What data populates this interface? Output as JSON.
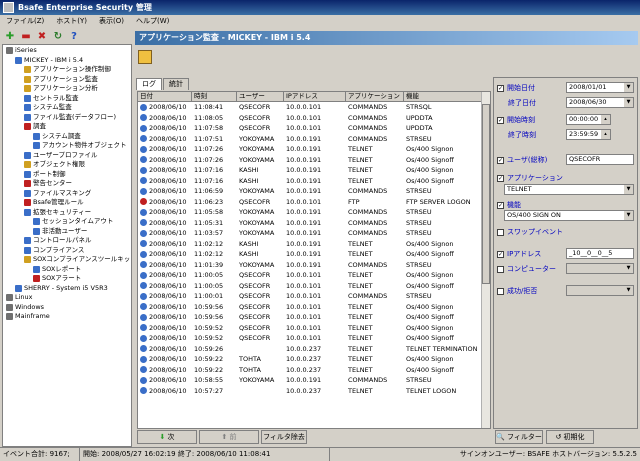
{
  "window": {
    "title": "Bsafe Enterprise Security 管理"
  },
  "menu": [
    "ファイル(Z)",
    "ホスト(Y)",
    "表示(O)",
    "ヘルプ(W)"
  ],
  "toolbar_icons": [
    {
      "name": "add-icon",
      "glyph": "✚",
      "color": "#2a9d2a"
    },
    {
      "name": "remove-icon",
      "glyph": "▬",
      "color": "#c02020"
    },
    {
      "name": "delete-icon",
      "glyph": "✖",
      "color": "#c02020"
    },
    {
      "name": "refresh-icon",
      "glyph": "↻",
      "color": "#2a7a2a"
    },
    {
      "name": "help-icon",
      "glyph": "?",
      "color": "#1f4fbf"
    }
  ],
  "tree": [
    {
      "label": "iSeries",
      "indent": 0,
      "color": "#707070"
    },
    {
      "label": "MICKEY - IBM i 5.4",
      "indent": 1,
      "color": "#3a6ec8"
    },
    {
      "label": "アプリケーション操作制御",
      "indent": 2,
      "color": "#d0a020"
    },
    {
      "label": "アプリケーション監査",
      "indent": 2,
      "color": "#d0a020"
    },
    {
      "label": "アプリケーション分析",
      "indent": 2,
      "color": "#d0a020"
    },
    {
      "label": "セントラル監査",
      "indent": 2,
      "color": "#3a6ec8"
    },
    {
      "label": "システム監査",
      "indent": 2,
      "color": "#3a6ec8"
    },
    {
      "label": "ファイル監査(データフロー)",
      "indent": 2,
      "color": "#3a6ec8"
    },
    {
      "label": "調査",
      "indent": 2,
      "color": "#c02020"
    },
    {
      "label": "システム調査",
      "indent": 3,
      "color": "#3a6ec8"
    },
    {
      "label": "アカウント物件オブジェクト",
      "indent": 3,
      "color": "#3a6ec8"
    },
    {
      "label": "ユーザープロファイル",
      "indent": 2,
      "color": "#3a6ec8"
    },
    {
      "label": "オブジェクト権限",
      "indent": 2,
      "color": "#d0a020"
    },
    {
      "label": "ポート制御",
      "indent": 2,
      "color": "#3a6ec8"
    },
    {
      "label": "警告センター",
      "indent": 2,
      "color": "#c02020"
    },
    {
      "label": "ファイルマスキング",
      "indent": 2,
      "color": "#3a6ec8"
    },
    {
      "label": "Bsafe管理ルール",
      "indent": 2,
      "color": "#c02020"
    },
    {
      "label": "拡張セキュリティー",
      "indent": 2,
      "color": "#3a6ec8"
    },
    {
      "label": "セッションタイムアウト",
      "indent": 3,
      "color": "#3a6ec8"
    },
    {
      "label": "非活動ユーザー",
      "indent": 3,
      "color": "#3a6ec8"
    },
    {
      "label": "コントロールパネル",
      "indent": 2,
      "color": "#3a6ec8"
    },
    {
      "label": "コンプライアンス",
      "indent": 2,
      "color": "#3a6ec8"
    },
    {
      "label": "SOXコンプライアンスツールキット",
      "indent": 2,
      "color": "#d0a020"
    },
    {
      "label": "SOXレポート",
      "indent": 3,
      "color": "#3a6ec8"
    },
    {
      "label": "SOXアラート",
      "indent": 3,
      "color": "#c02020"
    },
    {
      "label": "SHERRY - System i5 V5R3",
      "indent": 1,
      "color": "#3a6ec8"
    },
    {
      "label": "Linux",
      "indent": 0,
      "color": "#707070"
    },
    {
      "label": "Windows",
      "indent": 0,
      "color": "#707070"
    },
    {
      "label": "Mainframe",
      "indent": 0,
      "color": "#707070"
    }
  ],
  "pane": {
    "title": "アプリケーション監査 - MICKEY - IBM i 5.4"
  },
  "tabs": [
    "ログ",
    "統計"
  ],
  "columns": [
    "日付",
    "時刻",
    "ユーザー",
    "IPアドレス",
    "アプリケーション",
    "機能"
  ],
  "rows": [
    [
      "2008/06/10",
      "11:08:41",
      "QSECOFR",
      "10.0.0.101",
      "COMMANDS",
      "STRSQL",
      "info"
    ],
    [
      "2008/06/10",
      "11:08:05",
      "QSECOFR",
      "10.0.0.101",
      "COMMANDS",
      "UPDDTA",
      "info"
    ],
    [
      "2008/06/10",
      "11:07:58",
      "QSECOFR",
      "10.0.0.101",
      "COMMANDS",
      "UPDDTA",
      "info"
    ],
    [
      "2008/06/10",
      "11:07:51",
      "YOKOYAMA",
      "10.0.0.191",
      "COMMANDS",
      "STRSEU",
      "info"
    ],
    [
      "2008/06/10",
      "11:07:26",
      "YOKOYAMA",
      "10.0.0.191",
      "TELNET",
      "Os/400 Signon",
      "info"
    ],
    [
      "2008/06/10",
      "11:07:26",
      "YOKOYAMA",
      "10.0.0.191",
      "TELNET",
      "Os/400 Signoff",
      "info"
    ],
    [
      "2008/06/10",
      "11:07:16",
      "KASHI",
      "10.0.0.191",
      "TELNET",
      "Os/400 Signon",
      "info"
    ],
    [
      "2008/06/10",
      "11:07:16",
      "KASHI",
      "10.0.0.191",
      "TELNET",
      "Os/400 Signoff",
      "info"
    ],
    [
      "2008/06/10",
      "11:06:59",
      "YOKOYAMA",
      "10.0.0.191",
      "COMMANDS",
      "STRSEU",
      "info"
    ],
    [
      "2008/06/10",
      "11:06:23",
      "QSECOFR",
      "10.0.0.101",
      "FTP",
      "FTP SERVER LOGON",
      "err"
    ],
    [
      "2008/06/10",
      "11:05:58",
      "YOKOYAMA",
      "10.0.0.191",
      "COMMANDS",
      "STRSEU",
      "info"
    ],
    [
      "2008/06/10",
      "11:05:31",
      "YOKOYAMA",
      "10.0.0.191",
      "COMMANDS",
      "STRSEU",
      "info"
    ],
    [
      "2008/06/10",
      "11:03:57",
      "YOKOYAMA",
      "10.0.0.191",
      "COMMANDS",
      "STRSEU",
      "info"
    ],
    [
      "2008/06/10",
      "11:02:12",
      "KASHI",
      "10.0.0.191",
      "TELNET",
      "Os/400 Signon",
      "info"
    ],
    [
      "2008/06/10",
      "11:02:12",
      "KASHI",
      "10.0.0.191",
      "TELNET",
      "Os/400 Signoff",
      "info"
    ],
    [
      "2008/06/10",
      "11:01:39",
      "YOKOYAMA",
      "10.0.0.191",
      "COMMANDS",
      "STRSEU",
      "info"
    ],
    [
      "2008/06/10",
      "11:00:05",
      "QSECOFR",
      "10.0.0.101",
      "TELNET",
      "Os/400 Signon",
      "info"
    ],
    [
      "2008/06/10",
      "11:00:05",
      "QSECOFR",
      "10.0.0.101",
      "TELNET",
      "Os/400 Signoff",
      "info"
    ],
    [
      "2008/06/10",
      "11:00:01",
      "QSECOFR",
      "10.0.0.101",
      "COMMANDS",
      "STRSEU",
      "info"
    ],
    [
      "2008/06/10",
      "10:59:56",
      "QSECOFR",
      "10.0.0.101",
      "TELNET",
      "Os/400 Signon",
      "info"
    ],
    [
      "2008/06/10",
      "10:59:56",
      "QSECOFR",
      "10.0.0.101",
      "TELNET",
      "Os/400 Signoff",
      "info"
    ],
    [
      "2008/06/10",
      "10:59:52",
      "QSECOFR",
      "10.0.0.101",
      "TELNET",
      "Os/400 Signon",
      "info"
    ],
    [
      "2008/06/10",
      "10:59:52",
      "QSECOFR",
      "10.0.0.101",
      "TELNET",
      "Os/400 Signoff",
      "info"
    ],
    [
      "2008/06/10",
      "10:59:26",
      "",
      "10.0.0.237",
      "TELNET",
      "TELNET TERMINATION",
      "info"
    ],
    [
      "2008/06/10",
      "10:59:22",
      "TOHTA",
      "10.0.0.237",
      "TELNET",
      "Os/400 Signon",
      "info"
    ],
    [
      "2008/06/10",
      "10:59:22",
      "TOHTA",
      "10.0.0.237",
      "TELNET",
      "Os/400 Signoff",
      "info"
    ],
    [
      "2008/06/10",
      "10:58:55",
      "YOKOYAMA",
      "10.0.0.191",
      "COMMANDS",
      "STRSEU",
      "info"
    ],
    [
      "2008/06/10",
      "10:57:27",
      "",
      "10.0.0.237",
      "TELNET",
      "TELNET LOGON",
      "info"
    ]
  ],
  "grid_buttons": {
    "next": "次",
    "prev": "前",
    "clear": "フィルタ除去"
  },
  "filters": {
    "start_date_label": "開始日付",
    "start_date": "2008/01/01",
    "end_date_label": "終了日付",
    "end_date": "2008/06/30",
    "start_time_label": "開始時刻",
    "start_time": "00:00:00",
    "end_time_label": "終了時刻",
    "end_time": "23:59:59",
    "user_label": "ユーザ(総称)",
    "user": "QSECOFR",
    "app_label": "アプリケーション",
    "app": "TELNET",
    "func_label": "機能",
    "func": "OS/400 SIGN ON",
    "swap_label": "スワップイベント",
    "ip_label": "IPアドレス",
    "ip": "_10__0__0__5",
    "computer_label": "コンピューター",
    "result_label": "成功/拒否",
    "filter_btn": "フィルター",
    "reset_btn": "初期化"
  },
  "status": {
    "total": "イベント合計: 9167;",
    "range": "開始: 2008/05/27 16:02:19 終了: 2008/06/10 11:08:41",
    "signon": "サインオンユーザー: BSAFE ホストバージョン: 5.5.2.5"
  }
}
